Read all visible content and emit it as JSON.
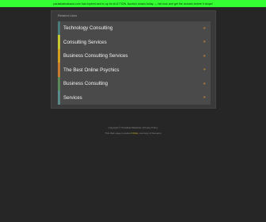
{
  "topbar": {
    "text": "parakkatmakana.com has expired and is up for AUCTION. Auction closes today — bid now and get the domain before it drops!",
    "color": "#33ff33"
  },
  "panel": {
    "label": "Related Links"
  },
  "links": [
    {
      "label": "Technology Consulting",
      "arrow": "»",
      "bar_color": "#4a7a7a"
    },
    {
      "label": "Consulting Services",
      "arrow": "»",
      "bar_color": "#c8c830"
    },
    {
      "label": "Business Consulting Services",
      "arrow": "»",
      "bar_color": "#d4a020"
    },
    {
      "label": "The Best Online Psychics",
      "arrow": "»",
      "bar_color": "#c87a30"
    },
    {
      "label": "Business Consulting",
      "arrow": "»",
      "bar_color": "#5a8a5a"
    },
    {
      "label": "Services",
      "arrow": "»",
      "bar_color": "#5a8a8a"
    }
  ],
  "footer": {
    "line1_a": "Copyright © Parakkat Makkana",
    "line1_sep": " | ",
    "line1_b": "Privacy Policy",
    "line2_a": "This Web page is parked ",
    "line2_b": "FREE",
    "line2_c": ", courtesy of Domains"
  }
}
